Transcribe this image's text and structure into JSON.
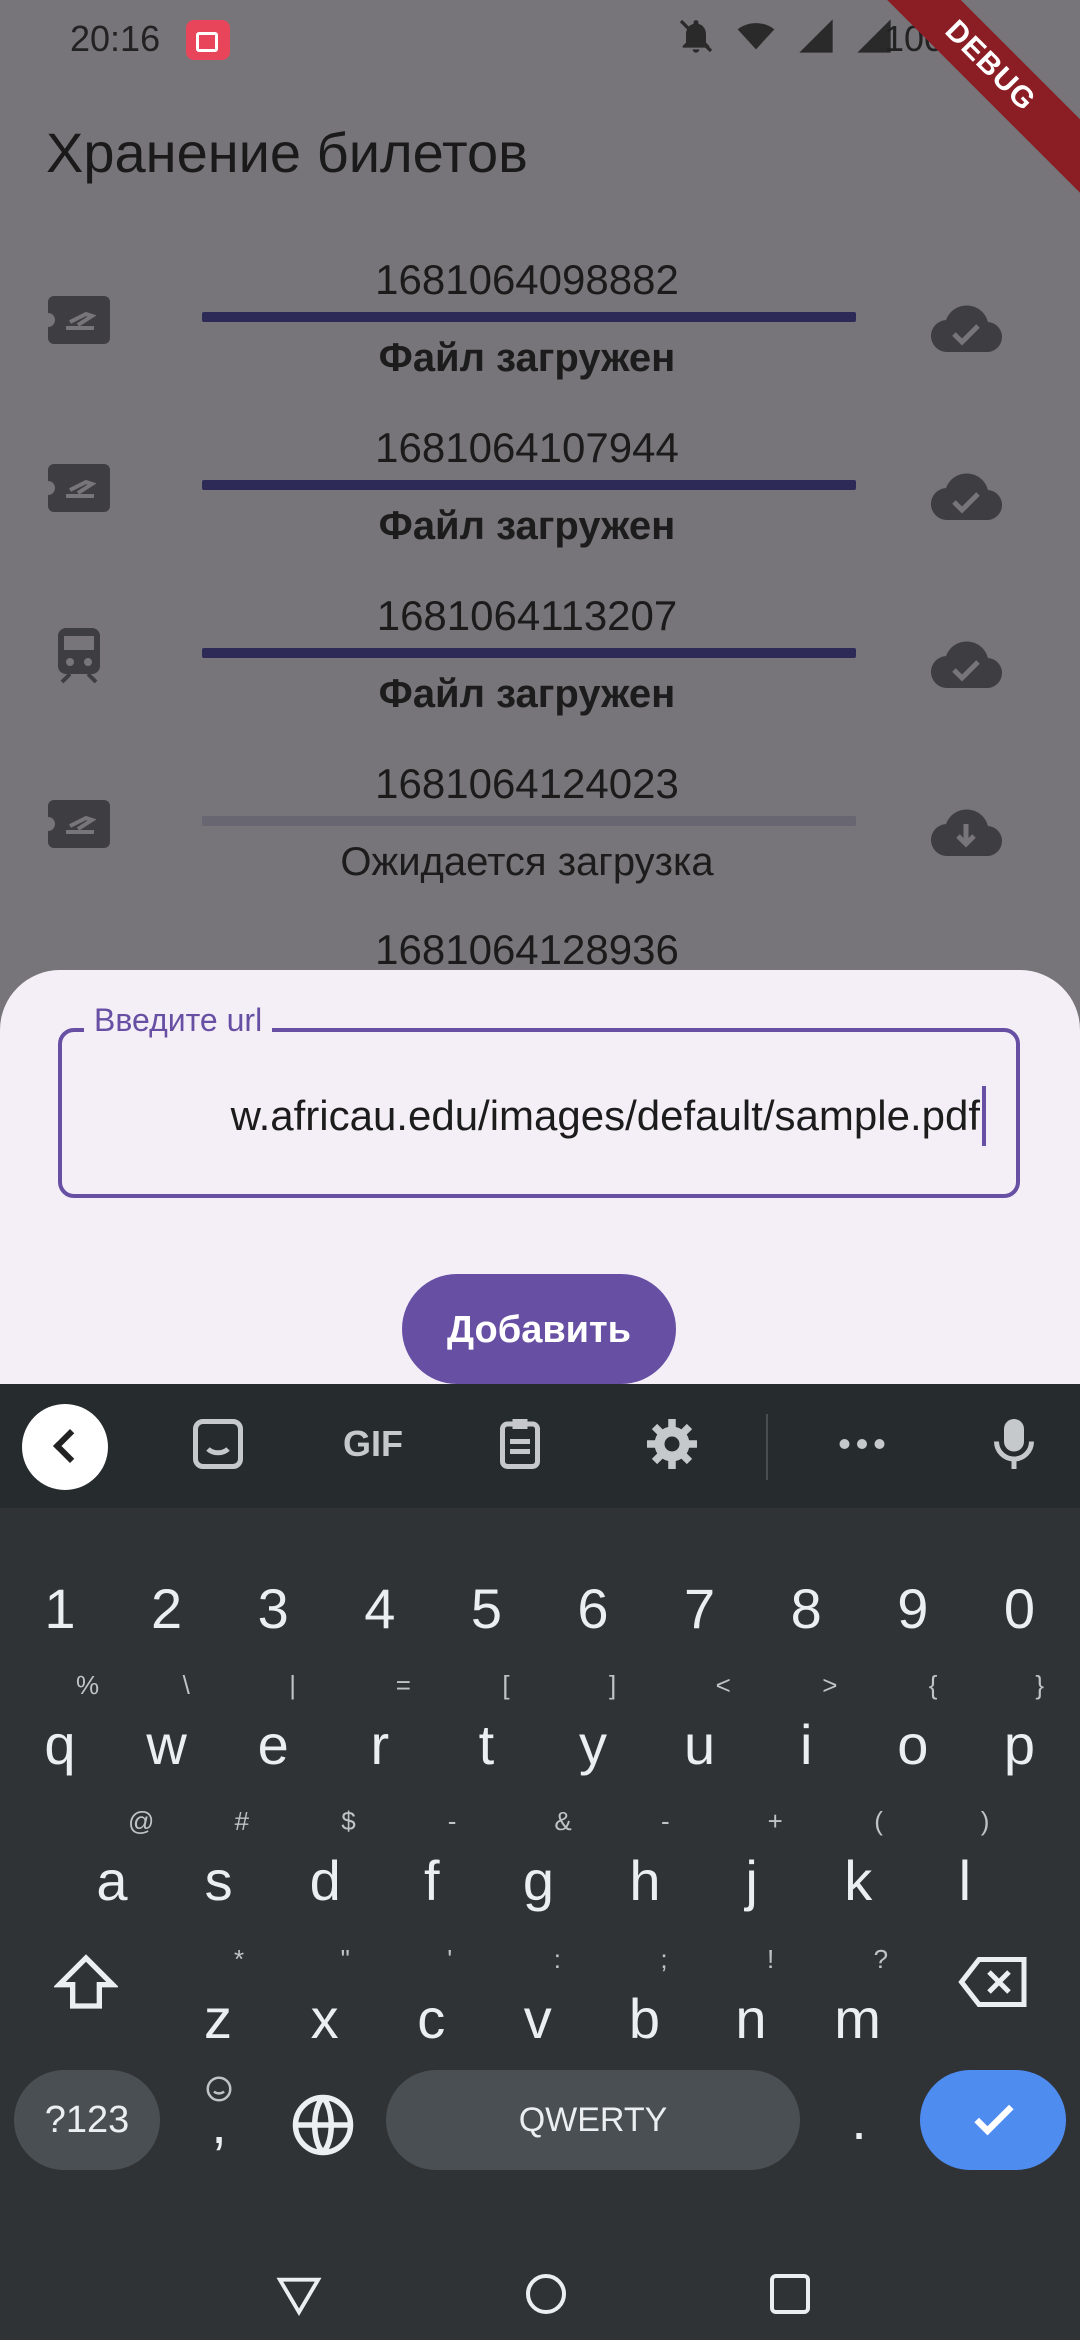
{
  "status_bar": {
    "time": "20:16",
    "battery": "100 %",
    "debug_label": "DEBUG"
  },
  "app": {
    "title": "Хранение билетов"
  },
  "tickets": [
    {
      "type": "flight",
      "id": "1681064098882",
      "progress": 1.0,
      "status": "Файл загружен",
      "cloud": "cloud-done-icon"
    },
    {
      "type": "flight",
      "id": "1681064107944",
      "progress": 1.0,
      "status": "Файл загружен",
      "cloud": "cloud-done-icon"
    },
    {
      "type": "train",
      "id": "1681064113207",
      "progress": 1.0,
      "status": "Файл загружен",
      "cloud": "cloud-done-icon"
    },
    {
      "type": "flight",
      "id": "1681064124023",
      "progress": 0.0,
      "status": "Ожидается загрузка",
      "cloud": "cloud-download-icon"
    },
    {
      "type": "flight",
      "id": "1681064128936"
    }
  ],
  "sheet": {
    "url_label": "Введите url",
    "url_value": "w.africau.edu/images/default/sample.pdf",
    "add_button": "Добавить"
  },
  "keyboard": {
    "toolbar": {
      "gif": "GIF"
    },
    "number_row": [
      "1",
      "2",
      "3",
      "4",
      "5",
      "6",
      "7",
      "8",
      "9",
      "0"
    ],
    "row1": [
      {
        "k": "q",
        "h": "%"
      },
      {
        "k": "w",
        "h": "\\"
      },
      {
        "k": "e",
        "h": "|"
      },
      {
        "k": "r",
        "h": "="
      },
      {
        "k": "t",
        "h": "["
      },
      {
        "k": "y",
        "h": "]"
      },
      {
        "k": "u",
        "h": "<"
      },
      {
        "k": "i",
        "h": ">"
      },
      {
        "k": "o",
        "h": "{"
      },
      {
        "k": "p",
        "h": "}"
      }
    ],
    "row2": [
      {
        "k": "a",
        "h": "@"
      },
      {
        "k": "s",
        "h": "#"
      },
      {
        "k": "d",
        "h": "$"
      },
      {
        "k": "f",
        "h": "-"
      },
      {
        "k": "g",
        "h": "&"
      },
      {
        "k": "h",
        "h": "-"
      },
      {
        "k": "j",
        "h": "+"
      },
      {
        "k": "k",
        "h": "("
      },
      {
        "k": "l",
        "h": ")"
      }
    ],
    "row3": [
      {
        "k": "z",
        "h": "*"
      },
      {
        "k": "x",
        "h": "\""
      },
      {
        "k": "c",
        "h": "'"
      },
      {
        "k": "v",
        "h": ":"
      },
      {
        "k": "b",
        "h": ";"
      },
      {
        "k": "n",
        "h": "!"
      },
      {
        "k": "m",
        "h": "?"
      }
    ],
    "symbols_key": "?123",
    "comma_key": ",",
    "space_key": "QWERTY",
    "period_key": ".",
    "colors": {
      "enter_key": "#4e8cf0",
      "accent": "#6750a4"
    }
  }
}
